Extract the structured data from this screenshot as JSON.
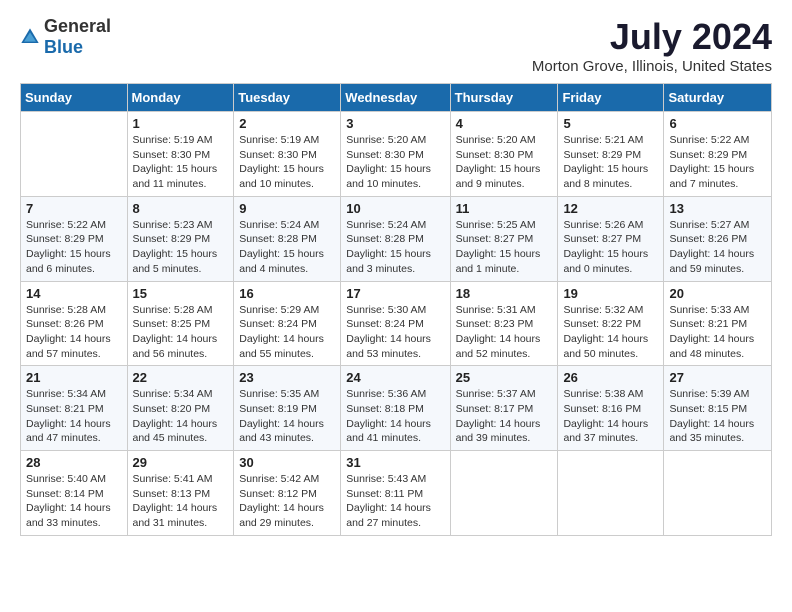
{
  "logo": {
    "general": "General",
    "blue": "Blue"
  },
  "title": "July 2024",
  "location": "Morton Grove, Illinois, United States",
  "days_of_week": [
    "Sunday",
    "Monday",
    "Tuesday",
    "Wednesday",
    "Thursday",
    "Friday",
    "Saturday"
  ],
  "weeks": [
    [
      {
        "day": "",
        "info": ""
      },
      {
        "day": "1",
        "info": "Sunrise: 5:19 AM\nSunset: 8:30 PM\nDaylight: 15 hours\nand 11 minutes."
      },
      {
        "day": "2",
        "info": "Sunrise: 5:19 AM\nSunset: 8:30 PM\nDaylight: 15 hours\nand 10 minutes."
      },
      {
        "day": "3",
        "info": "Sunrise: 5:20 AM\nSunset: 8:30 PM\nDaylight: 15 hours\nand 10 minutes."
      },
      {
        "day": "4",
        "info": "Sunrise: 5:20 AM\nSunset: 8:30 PM\nDaylight: 15 hours\nand 9 minutes."
      },
      {
        "day": "5",
        "info": "Sunrise: 5:21 AM\nSunset: 8:29 PM\nDaylight: 15 hours\nand 8 minutes."
      },
      {
        "day": "6",
        "info": "Sunrise: 5:22 AM\nSunset: 8:29 PM\nDaylight: 15 hours\nand 7 minutes."
      }
    ],
    [
      {
        "day": "7",
        "info": "Sunrise: 5:22 AM\nSunset: 8:29 PM\nDaylight: 15 hours\nand 6 minutes."
      },
      {
        "day": "8",
        "info": "Sunrise: 5:23 AM\nSunset: 8:29 PM\nDaylight: 15 hours\nand 5 minutes."
      },
      {
        "day": "9",
        "info": "Sunrise: 5:24 AM\nSunset: 8:28 PM\nDaylight: 15 hours\nand 4 minutes."
      },
      {
        "day": "10",
        "info": "Sunrise: 5:24 AM\nSunset: 8:28 PM\nDaylight: 15 hours\nand 3 minutes."
      },
      {
        "day": "11",
        "info": "Sunrise: 5:25 AM\nSunset: 8:27 PM\nDaylight: 15 hours\nand 1 minute."
      },
      {
        "day": "12",
        "info": "Sunrise: 5:26 AM\nSunset: 8:27 PM\nDaylight: 15 hours\nand 0 minutes."
      },
      {
        "day": "13",
        "info": "Sunrise: 5:27 AM\nSunset: 8:26 PM\nDaylight: 14 hours\nand 59 minutes."
      }
    ],
    [
      {
        "day": "14",
        "info": "Sunrise: 5:28 AM\nSunset: 8:26 PM\nDaylight: 14 hours\nand 57 minutes."
      },
      {
        "day": "15",
        "info": "Sunrise: 5:28 AM\nSunset: 8:25 PM\nDaylight: 14 hours\nand 56 minutes."
      },
      {
        "day": "16",
        "info": "Sunrise: 5:29 AM\nSunset: 8:24 PM\nDaylight: 14 hours\nand 55 minutes."
      },
      {
        "day": "17",
        "info": "Sunrise: 5:30 AM\nSunset: 8:24 PM\nDaylight: 14 hours\nand 53 minutes."
      },
      {
        "day": "18",
        "info": "Sunrise: 5:31 AM\nSunset: 8:23 PM\nDaylight: 14 hours\nand 52 minutes."
      },
      {
        "day": "19",
        "info": "Sunrise: 5:32 AM\nSunset: 8:22 PM\nDaylight: 14 hours\nand 50 minutes."
      },
      {
        "day": "20",
        "info": "Sunrise: 5:33 AM\nSunset: 8:21 PM\nDaylight: 14 hours\nand 48 minutes."
      }
    ],
    [
      {
        "day": "21",
        "info": "Sunrise: 5:34 AM\nSunset: 8:21 PM\nDaylight: 14 hours\nand 47 minutes."
      },
      {
        "day": "22",
        "info": "Sunrise: 5:34 AM\nSunset: 8:20 PM\nDaylight: 14 hours\nand 45 minutes."
      },
      {
        "day": "23",
        "info": "Sunrise: 5:35 AM\nSunset: 8:19 PM\nDaylight: 14 hours\nand 43 minutes."
      },
      {
        "day": "24",
        "info": "Sunrise: 5:36 AM\nSunset: 8:18 PM\nDaylight: 14 hours\nand 41 minutes."
      },
      {
        "day": "25",
        "info": "Sunrise: 5:37 AM\nSunset: 8:17 PM\nDaylight: 14 hours\nand 39 minutes."
      },
      {
        "day": "26",
        "info": "Sunrise: 5:38 AM\nSunset: 8:16 PM\nDaylight: 14 hours\nand 37 minutes."
      },
      {
        "day": "27",
        "info": "Sunrise: 5:39 AM\nSunset: 8:15 PM\nDaylight: 14 hours\nand 35 minutes."
      }
    ],
    [
      {
        "day": "28",
        "info": "Sunrise: 5:40 AM\nSunset: 8:14 PM\nDaylight: 14 hours\nand 33 minutes."
      },
      {
        "day": "29",
        "info": "Sunrise: 5:41 AM\nSunset: 8:13 PM\nDaylight: 14 hours\nand 31 minutes."
      },
      {
        "day": "30",
        "info": "Sunrise: 5:42 AM\nSunset: 8:12 PM\nDaylight: 14 hours\nand 29 minutes."
      },
      {
        "day": "31",
        "info": "Sunrise: 5:43 AM\nSunset: 8:11 PM\nDaylight: 14 hours\nand 27 minutes."
      },
      {
        "day": "",
        "info": ""
      },
      {
        "day": "",
        "info": ""
      },
      {
        "day": "",
        "info": ""
      }
    ]
  ]
}
